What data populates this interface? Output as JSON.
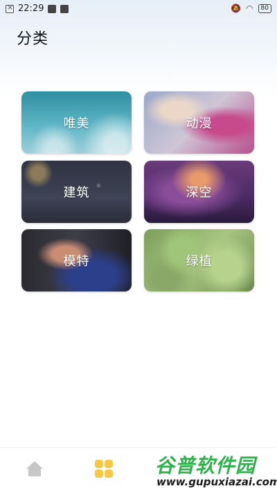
{
  "status_bar": {
    "time": "22:29",
    "battery": "80"
  },
  "header": {
    "title": "分类"
  },
  "categories": [
    {
      "label": "唯美"
    },
    {
      "label": "动漫"
    },
    {
      "label": "建筑"
    },
    {
      "label": "深空"
    },
    {
      "label": "模特"
    },
    {
      "label": "绿植"
    }
  ],
  "bottom_nav": {
    "items": [
      {
        "icon": "home-icon"
      },
      {
        "icon": "category-grid-icon",
        "active_color": "#f7c843"
      }
    ]
  },
  "watermark": {
    "title": "谷普软件园",
    "url": "www.gupuxiazai.com"
  }
}
